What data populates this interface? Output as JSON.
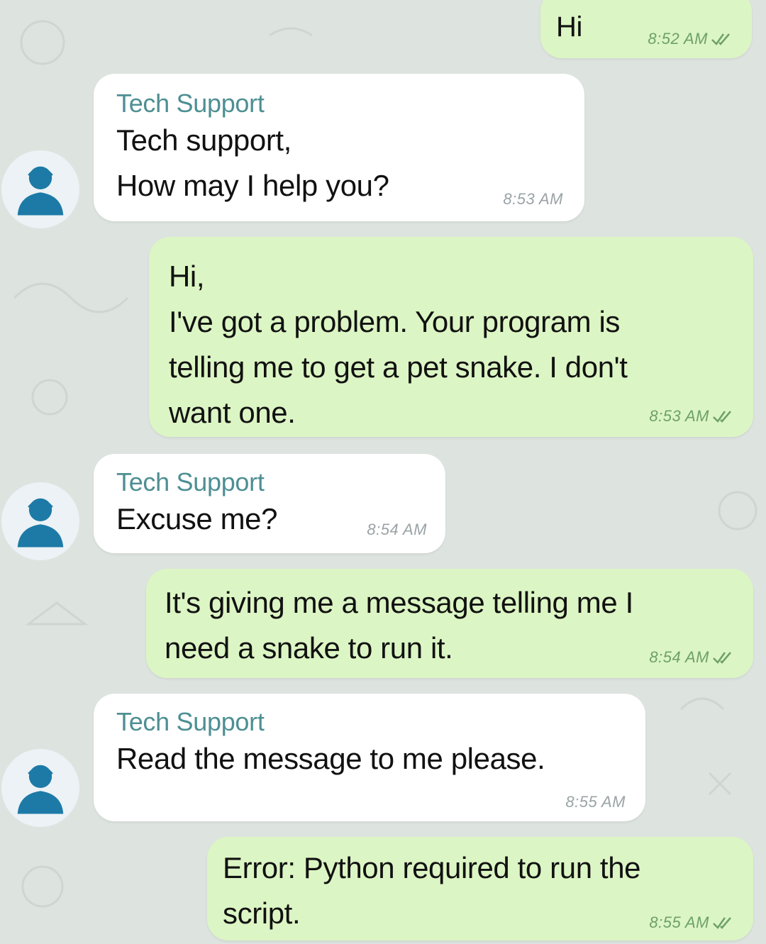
{
  "colors": {
    "outgoing_bubble": "#dcf5c4",
    "incoming_bubble": "#ffffff",
    "sender_name": "#4e8f93",
    "avatar_icon": "#1d7aa6",
    "background": "#dde3df"
  },
  "contact": {
    "name": "Tech Support",
    "avatar_icon": "support-agent-icon"
  },
  "messages": [
    {
      "direction": "outgoing",
      "text": "Hi",
      "time": "8:52 AM",
      "status": "read-double-check-icon"
    },
    {
      "direction": "incoming",
      "sender": "Tech Support",
      "text": "Tech support,\nHow may I help you?",
      "time": "8:53 AM"
    },
    {
      "direction": "outgoing",
      "text": "Hi,\nI've got a problem. Your program is\ntelling me to get a pet snake. I don't\nwant one.",
      "time": "8:53 AM",
      "status": "read-double-check-icon"
    },
    {
      "direction": "incoming",
      "sender": "Tech Support",
      "text": "Excuse me?",
      "time": "8:54 AM"
    },
    {
      "direction": "outgoing",
      "text": "It's giving me a message telling me I\nneed a snake to run it.",
      "time": "8:54 AM",
      "status": "read-double-check-icon"
    },
    {
      "direction": "incoming",
      "sender": "Tech Support",
      "text": "Read the message to me please.",
      "time": "8:55 AM"
    },
    {
      "direction": "outgoing",
      "text": "Error: Python required to run the\nscript.",
      "time": "8:55 AM",
      "status": "read-double-check-icon"
    }
  ]
}
